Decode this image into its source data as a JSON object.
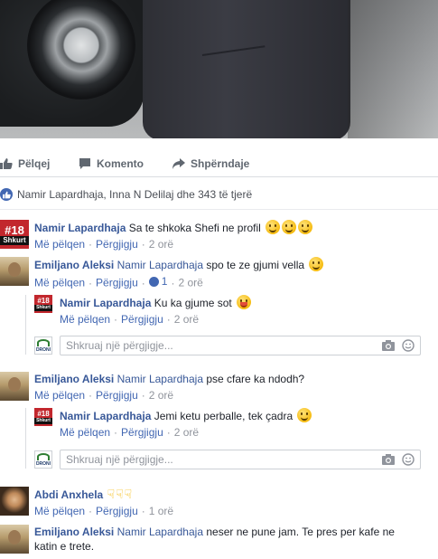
{
  "actions": {
    "like": "Pëlqej",
    "comment": "Komento",
    "share": "Shpërndaje"
  },
  "likes_summary": "Namir Lapardhaja, Inna N Delilaj dhe 343 të tjerë",
  "comments": [
    {
      "author": "Namir Lapardhaja",
      "mention": "",
      "text": "Sa te shkoka Shefi ne profil",
      "like_label": "Më pëlqen",
      "reply_label": "Përgjigju",
      "time": "2 orë"
    },
    {
      "author": "Emiljano Aleksi",
      "mention": "Namir Lapardhaja",
      "text": "spo te ze gjumi vella",
      "like_label": "Më pëlqen",
      "reply_label": "Përgjigju",
      "like_count": "1",
      "time": "2 orë",
      "replies": [
        {
          "author": "Namir Lapardhaja",
          "text": "Ku ka gjume sot",
          "like_label": "Më pëlqen",
          "reply_label": "Përgjigju",
          "time": "2 orë"
        }
      ]
    },
    {
      "author": "Emiljano Aleksi",
      "mention": "Namir Lapardhaja",
      "text": "pse cfare ka ndodh?",
      "like_label": "Më pëlqen",
      "reply_label": "Përgjigju",
      "time": "2 orë",
      "replies": [
        {
          "author": "Namir Lapardhaja",
          "text": "Jemi ketu perballe, tek çadra",
          "like_label": "Më pëlqen",
          "reply_label": "Përgjigju",
          "time": "2 orë"
        }
      ]
    },
    {
      "author": "Abdi Anxhela",
      "mention": "",
      "text": "",
      "like_label": "Më pëlqen",
      "reply_label": "Përgjigju",
      "time": "1 orë"
    },
    {
      "author": "Emiljano Aleksi",
      "mention": "Namir Lapardhaja",
      "text": "neser ne pune jam. Te pres per kafe ne katin e trete."
    }
  ],
  "reply_placeholder": "Shkruaj një përgjigje...",
  "avatar_badges": {
    "hash18": "#18",
    "shkurt": "Shkurt",
    "droni": "DRONI"
  },
  "icons": {
    "like": "thumbs-up-icon",
    "comment": "speech-bubble-icon",
    "share": "share-arrow-icon",
    "camera": "camera-icon",
    "emoji": "smiley-icon"
  },
  "colors": {
    "link": "#385898",
    "accent": "#4267b2",
    "meta": "#90949c"
  }
}
